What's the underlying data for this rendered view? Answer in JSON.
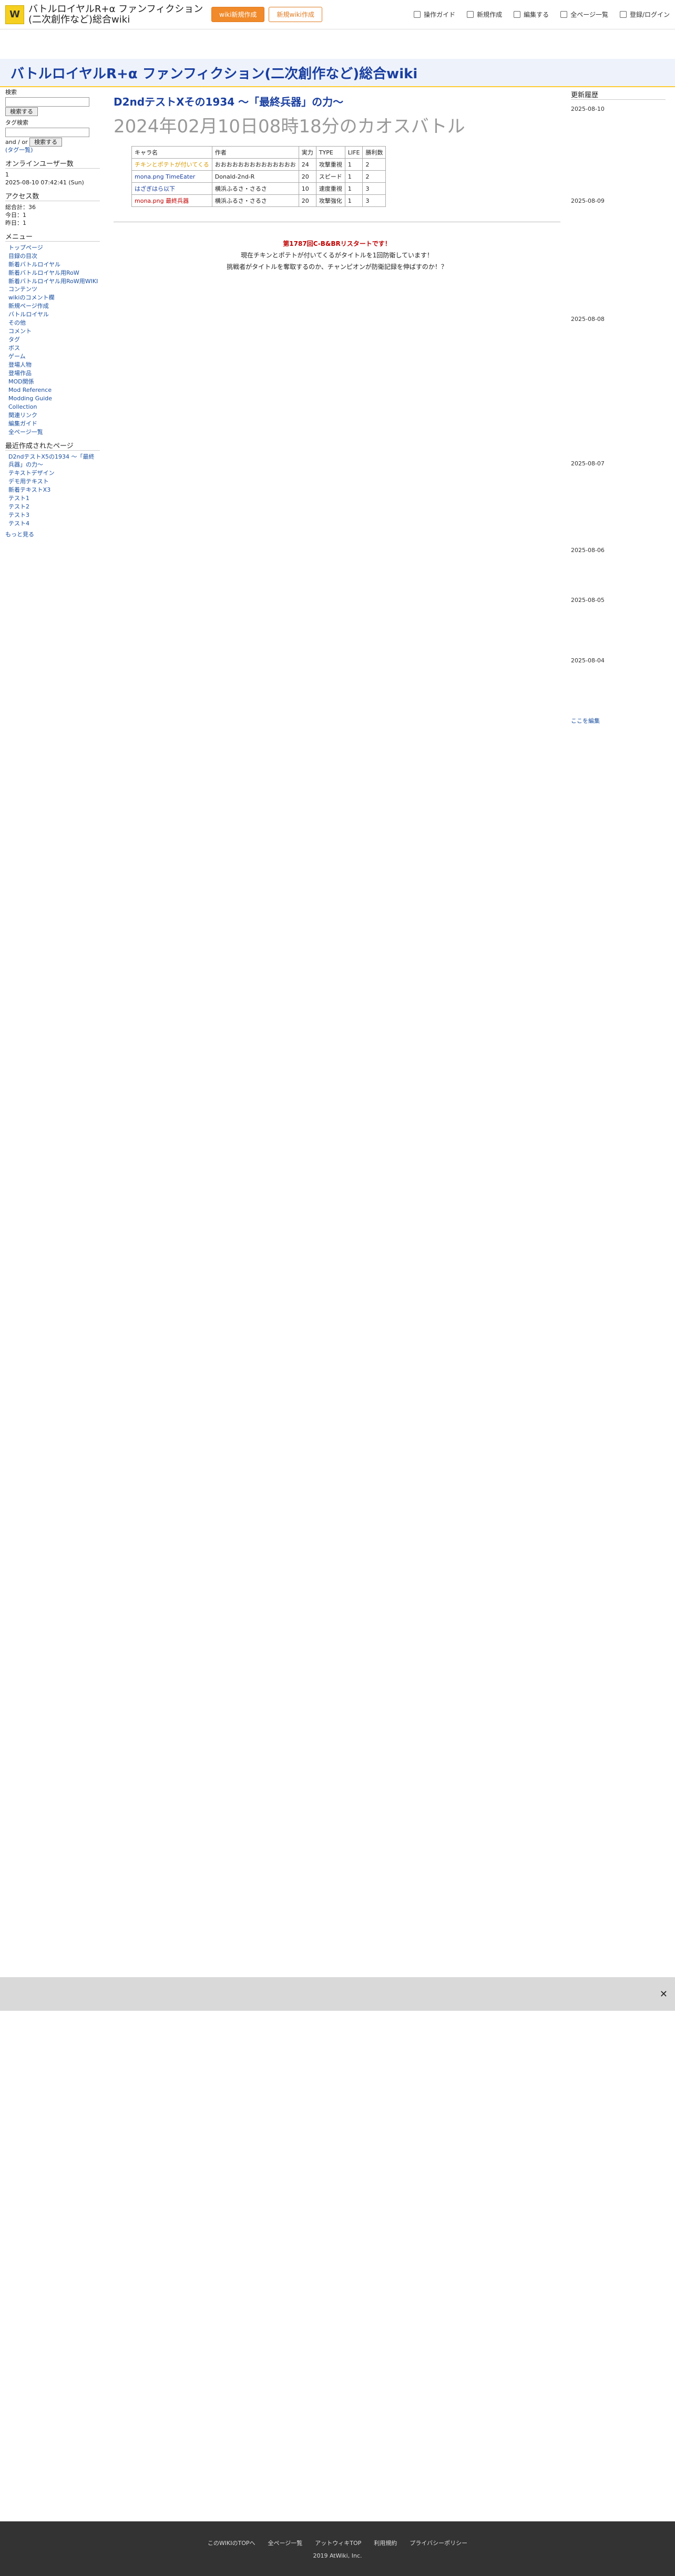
{
  "topbar": {
    "site_title": "バトルロイヤルR+α ファンフィクション(二次創作など)総合wiki",
    "btn_new": "wiki新規作成",
    "btn_wiki": "新規wiki作成",
    "nav": [
      "操作ガイド",
      "新規作成",
      "編集する",
      "全ページ一覧",
      "登録/ログイン"
    ]
  },
  "header": {
    "title": "バトルロイヤルR+α ファンフィクション(二次創作など)総合wiki"
  },
  "left": {
    "search_label": "検索",
    "search_btn": "検索する",
    "tag_label": "タグ検索",
    "and": "and",
    "or": "or",
    "tag_btn": "検索する",
    "tag_note": "(タグ一覧)",
    "online_title": "オンラインユーザー数",
    "online_count": "1",
    "date": "2025-08-10 07:42:41 (Sun)",
    "access_title": "アクセス数",
    "access": [
      "総合計：36",
      "今日：1",
      "昨日：1"
    ],
    "menu_title": "メニュー",
    "menu": [
      "トップページ",
      "目録の目次",
      "新着バトルロイヤル",
      "新着バトルロイヤル用RoW",
      "新着バトルロイヤル用RoW用WIKIコンテンツ",
      "wikiのコメント欄",
      "新規ページ作成",
      "バトルロイヤル",
      "その他",
      "コメント",
      "タグ",
      "ボス",
      "ゲーム",
      "登場人物",
      "登場作品",
      "MOD関係",
      "Mod Reference",
      "Modding Guide",
      "Collection",
      "関連リンク",
      "編集ガイド",
      "全ページ一覧"
    ],
    "recent_title": "最近作成されたページ",
    "recent": [
      "D2ndテストX5の1934 ～「最終兵器」の力～",
      "テキストデザイン",
      "デモ用テキスト",
      "新着テキストX3",
      "テスト1",
      "テスト2",
      "テスト3",
      "テスト4"
    ],
    "more": "もっと見る"
  },
  "main": {
    "title": "D2ndテストXその1934 ～「最終兵器」の力～",
    "subtitle": "2024年02月10日08時18分のカオスバトル",
    "ptable_headers": [
      "キャラ名",
      "作者",
      "実力",
      "TYPE",
      "LIFE",
      "勝利数"
    ],
    "ptable_rows": [
      [
        "チキンとポテトが付いてくる",
        "おおおおおおおおおおおおおお",
        "24",
        "攻撃重視",
        "1",
        "2"
      ],
      [
        "mona.png TimeEater",
        "Donald-2nd-R",
        "20",
        "スピード",
        "1",
        "2"
      ],
      [
        "はざぎはら以下",
        "横浜ふるさ・さるさ",
        "10",
        "速度重視",
        "1",
        "3"
      ],
      [
        "mona.png 最終兵器",
        "横浜ふるさ・さるさ",
        "20",
        "攻撃強化",
        "1",
        "3"
      ]
    ],
    "start_line1": "第1787回C-B&BRリスタートです！",
    "start_line2": "現在チキンとポテトが付いてくるがタイトルを1回防衛しています！",
    "start_line3": "挑戦者がタイトルを奪取するのか、チャンピオンが防衛記録を伸ばすのか！？"
  },
  "right": {
    "title": "更新履歴",
    "dates": [
      "2025-08-10",
      "2025-08-09",
      "2025-08-08",
      "2025-08-07",
      "2025-08-06",
      "2025-08-05",
      "2025-08-04"
    ],
    "more": "ここを編集"
  },
  "banner": {
    "close": "✕"
  },
  "footer": {
    "links": [
      "このWIKIのTOPへ",
      "全ページ一覧",
      "アットウィキTOP",
      "利用規約",
      "プライバシーポリシー"
    ],
    "copy": "2019 AtWiki, Inc."
  }
}
